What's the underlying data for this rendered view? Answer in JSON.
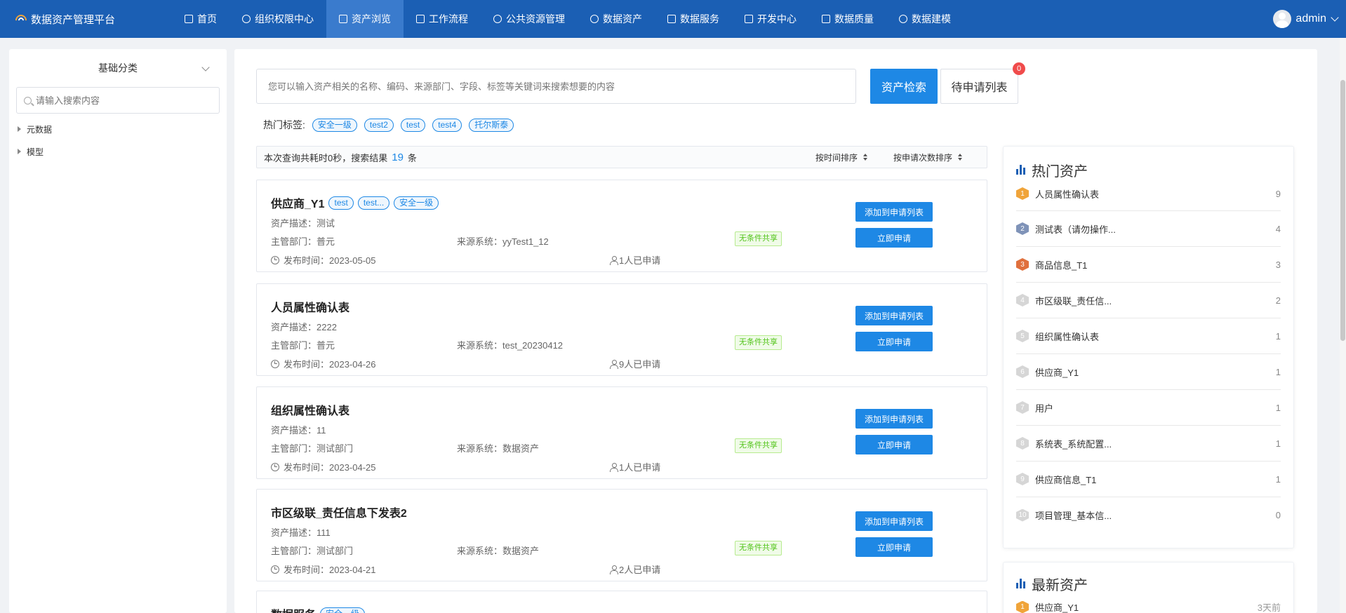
{
  "app": {
    "title": "数据资产管理平台"
  },
  "nav": {
    "items": [
      {
        "label": "首页"
      },
      {
        "label": "组织权限中心"
      },
      {
        "label": "资产浏览"
      },
      {
        "label": "工作流程"
      },
      {
        "label": "公共资源管理"
      },
      {
        "label": "数据资产"
      },
      {
        "label": "数据服务"
      },
      {
        "label": "开发中心"
      },
      {
        "label": "数据质量"
      },
      {
        "label": "数据建模"
      }
    ],
    "active": "资产浏览",
    "user": "admin"
  },
  "sidebar": {
    "title": "基础分类",
    "search_placeholder": "请输入搜索内容",
    "tree": [
      {
        "label": "元数据"
      },
      {
        "label": "模型"
      }
    ]
  },
  "search": {
    "placeholder": "您可以输入资产相关的名称、编码、来源部门、字段、标签等关键词来搜索想要的内容",
    "search_button": "资产检索",
    "pending_button": "待申请列表",
    "pending_count": "0"
  },
  "hot_tags": {
    "label": "热门标签:",
    "tags": [
      "安全一级",
      "test2",
      "test",
      "test4",
      "托尔斯泰"
    ]
  },
  "results": {
    "prefix": "本次查询共耗时0秒，搜索结果",
    "count": "19",
    "suffix": "条",
    "sort_time": "按时间排序",
    "sort_apply": "按申请次数排序"
  },
  "assets": [
    {
      "title": "供应商_Y1",
      "tags": [
        "test",
        "test...",
        "安全一级"
      ],
      "desc": "资产描述：测试",
      "dept": "主管部门：普元",
      "source": "来源系统：yyTest1_12",
      "share": "无条件共享",
      "date": "发布时间：2023-05-05",
      "applied": "1人已申请",
      "add_label": "添加到申请列表",
      "apply_label": "立即申请"
    },
    {
      "title": "人员属性确认表",
      "tags": [],
      "desc": "资产描述：2222",
      "dept": "主管部门：普元",
      "source": "来源系统：test_20230412",
      "share": "无条件共享",
      "date": "发布时间：2023-04-26",
      "applied": "9人已申请",
      "add_label": "添加到申请列表",
      "apply_label": "立即申请"
    },
    {
      "title": "组织属性确认表",
      "tags": [],
      "desc": "资产描述：11",
      "dept": "主管部门：测试部门",
      "source": "来源系统：数据资产",
      "share": "无条件共享",
      "date": "发布时间：2023-04-25",
      "applied": "1人已申请",
      "add_label": "添加到申请列表",
      "apply_label": "立即申请"
    },
    {
      "title": "市区级联_责任信息下发表2",
      "tags": [],
      "desc": "资产描述：111",
      "dept": "主管部门：测试部门",
      "source": "来源系统：数据资产",
      "share": "无条件共享",
      "date": "发布时间：2023-04-21",
      "applied": "2人已申请",
      "add_label": "添加到申请列表",
      "apply_label": "立即申请"
    },
    {
      "title": "数据服务",
      "tags": [
        "安全一级"
      ]
    }
  ],
  "hot_assets": {
    "title": "热门资产",
    "items": [
      {
        "rank": "1",
        "name": "人员属性确认表",
        "value": "9"
      },
      {
        "rank": "2",
        "name": "测试表（请勿操作...",
        "value": "4"
      },
      {
        "rank": "3",
        "name": "商品信息_T1",
        "value": "3"
      },
      {
        "rank": "4",
        "name": "市区级联_责任信...",
        "value": "2"
      },
      {
        "rank": "5",
        "name": "组织属性确认表",
        "value": "1"
      },
      {
        "rank": "6",
        "name": "供应商_Y1",
        "value": "1"
      },
      {
        "rank": "7",
        "name": "用户",
        "value": "1"
      },
      {
        "rank": "8",
        "name": "系统表_系统配置...",
        "value": "1"
      },
      {
        "rank": "9",
        "name": "供应商信息_T1",
        "value": "1"
      },
      {
        "rank": "10",
        "name": "项目管理_基本信...",
        "value": "0"
      }
    ]
  },
  "new_assets": {
    "title": "最新资产",
    "items": [
      {
        "rank": "1",
        "name": "供应商_Y1",
        "value": "3天前"
      }
    ]
  },
  "colors": {
    "nav_bg": "#1b5fb4",
    "nav_active": "#3a7bcd",
    "primary": "#1e88e5",
    "badge": "#f04b4b",
    "share_green": "#52c41a"
  }
}
